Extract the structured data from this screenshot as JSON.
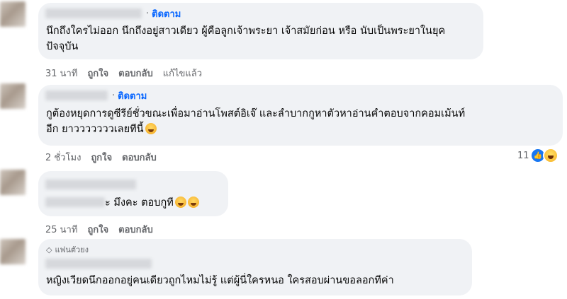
{
  "comments": [
    {
      "follow_label": "ติดตาม",
      "text_line1": "นึกถึงใครไม่ออก นึกถึงอยู่สาวเดียว ผู้คือลูกเจ้าพระยา เจ้าสมัยก่อน หรือ นับเป็นพระยาในยุค",
      "text_line2": "ปัจจุบัน",
      "time": "31 นาที",
      "like": "ถูกใจ",
      "reply": "ตอบกลับ",
      "edited": "แก้ไขแล้ว"
    },
    {
      "follow_label": "ติดตาม",
      "text_line1": "กูต้องหยุดการดูซีรีย์ชั่วขณะเพื่อมาอ่านโพสต์อิเจ๊ และลำบากกูหาตัวหาอ่านคำตอบจากคอมเม้นท์",
      "text_line2": "อีก ยาวววววววเลยทีนี้",
      "emoji": "rolling-laughing-emoji",
      "time": "2 ชั่วโมง",
      "like": "ถูกใจ",
      "reply": "ตอบกลับ",
      "reaction_count": "11",
      "reaction_icons": [
        "like-reaction-icon",
        "haha-reaction-icon"
      ]
    },
    {
      "text_line1": "ะ มึงคะ ตอบกูที",
      "emoji": [
        "laughing-emoji",
        "grinning-emoji"
      ],
      "time": "25 นาที",
      "like": "ถูกใจ",
      "reply": "ตอบกลับ"
    },
    {
      "badge": "แฟนตัวยง",
      "badge_icon": "diamond-icon",
      "text_line1": "หญิงเวียดนึกออกอยู่คนเดียวถูกไหมไม่รู้ แต่ผู้นี่ใครหนอ ใครสอบผ่านขอลอกทีค่า"
    }
  ],
  "colors": {
    "bubble": "#f0f2f5",
    "follow": "#0866ff",
    "meta": "#65676b",
    "like_reaction": "#1877f2"
  }
}
